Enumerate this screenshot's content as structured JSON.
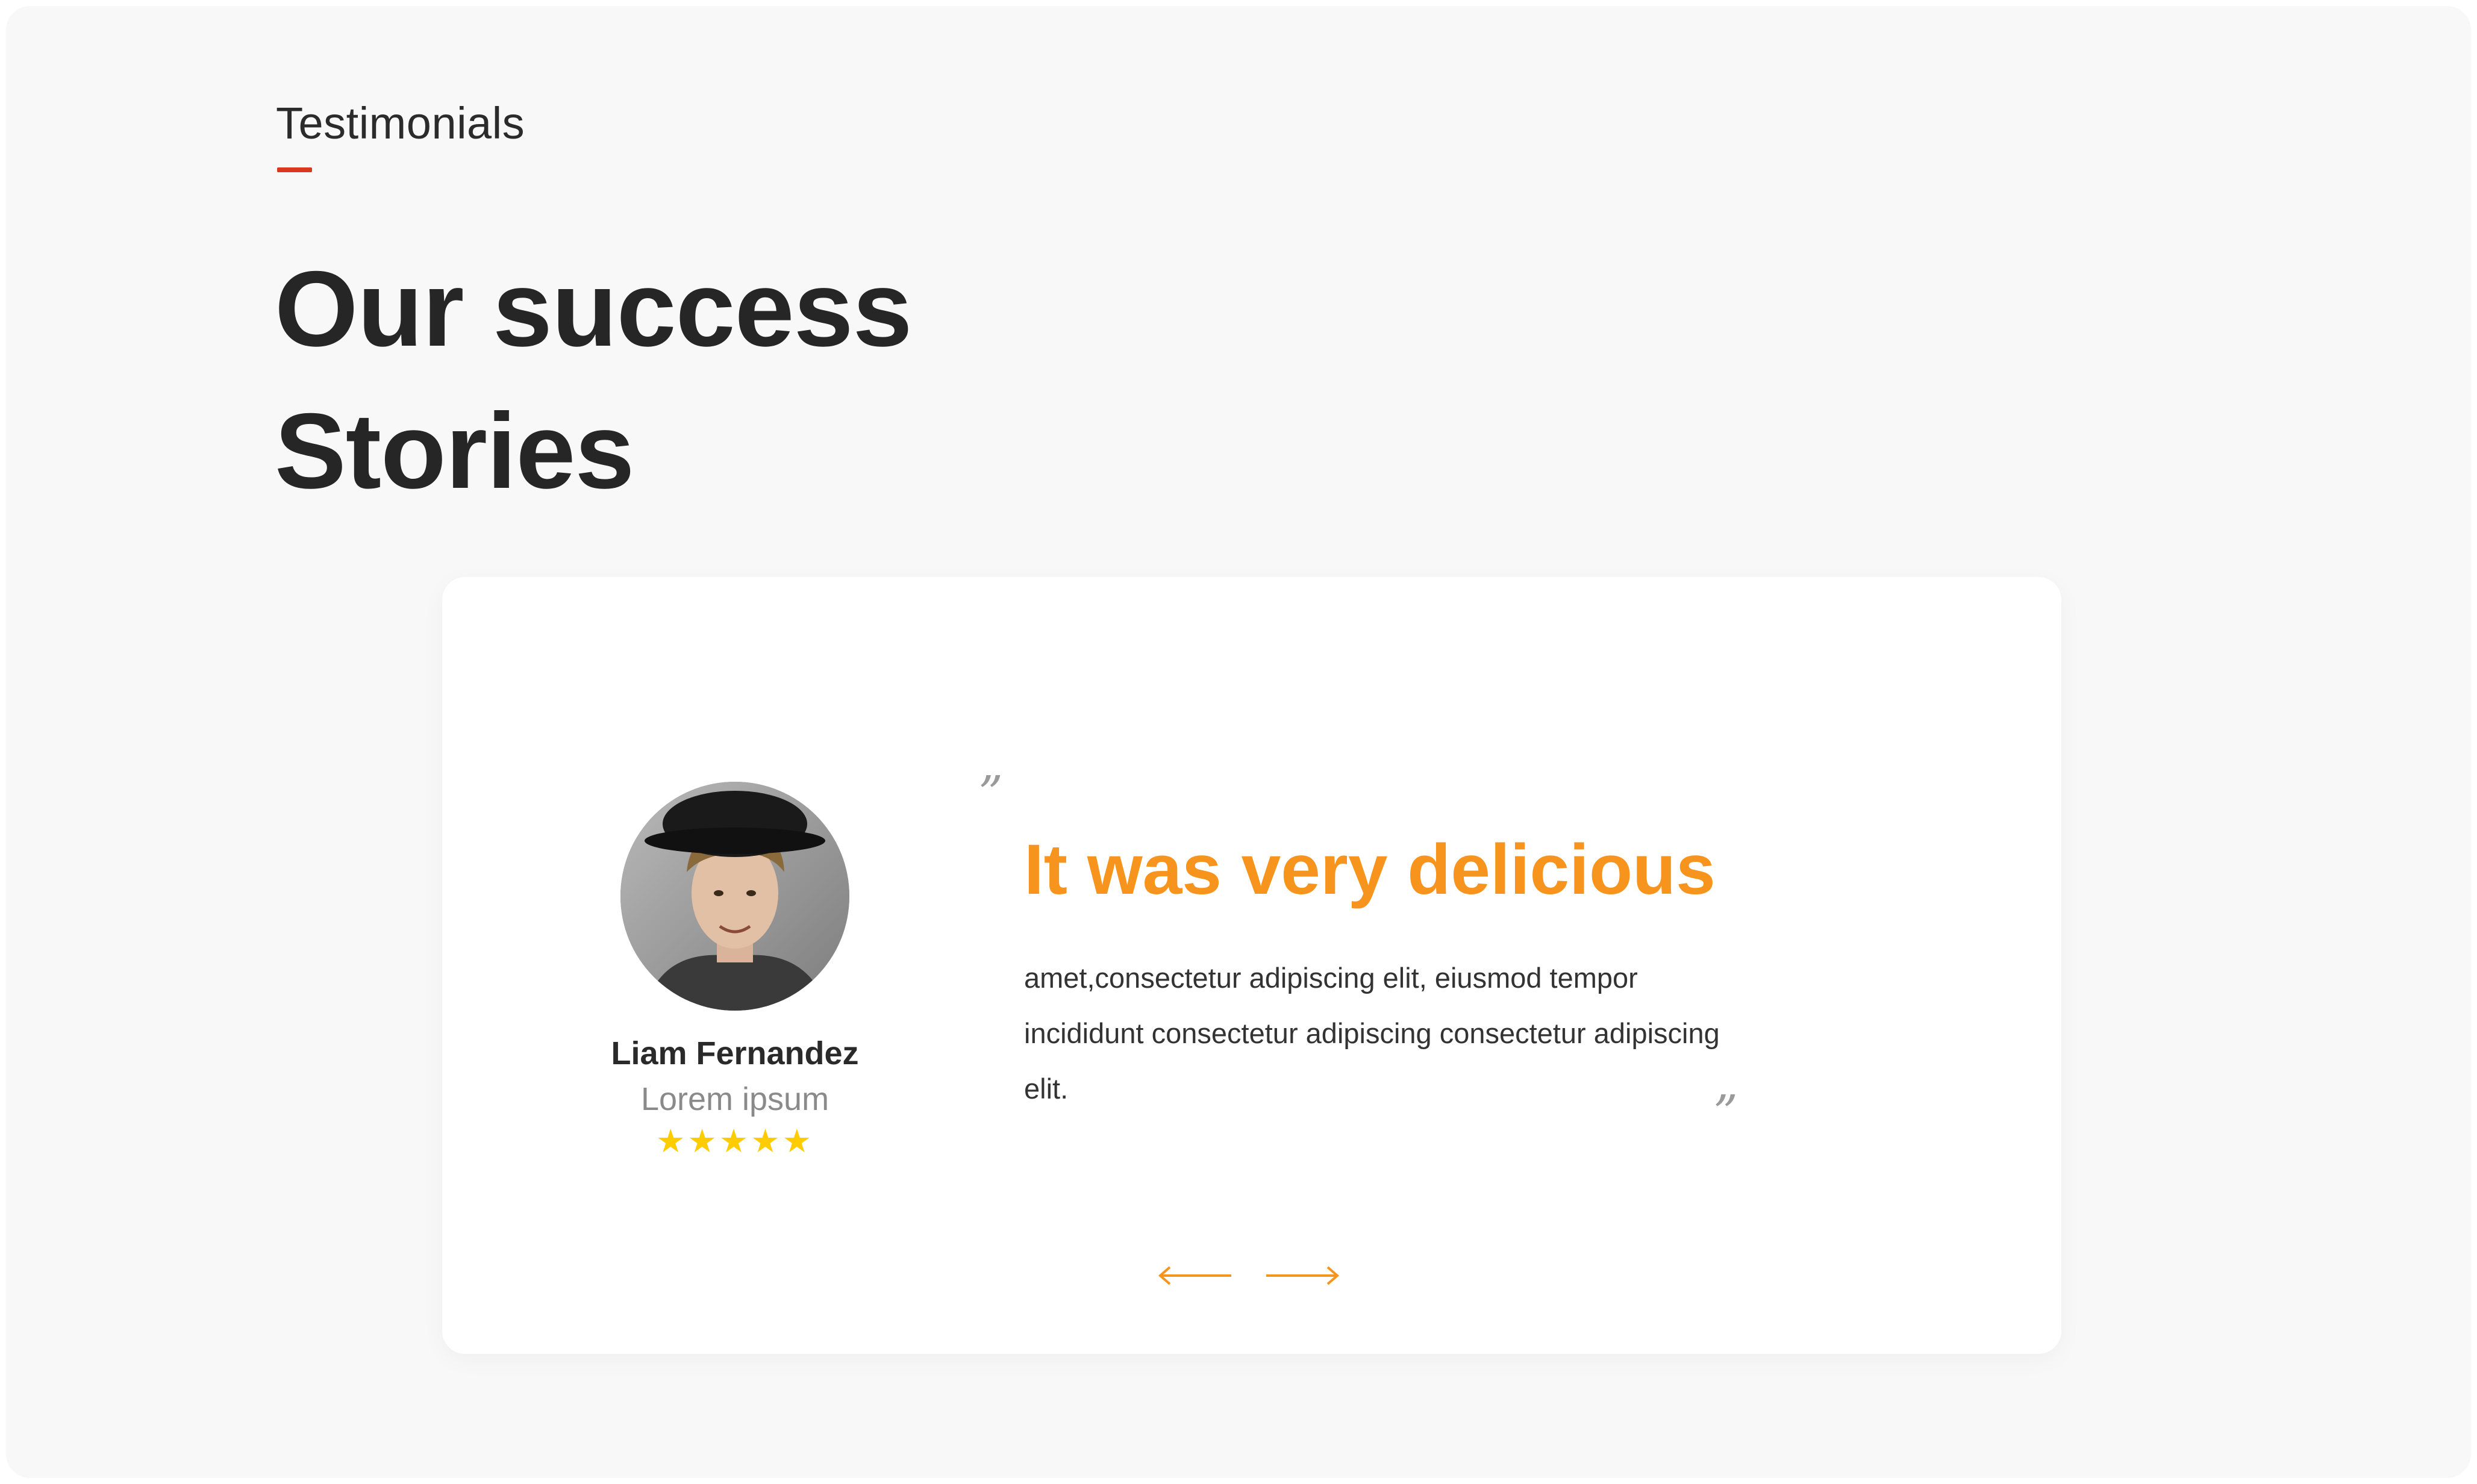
{
  "section": {
    "eyebrow": "Testimonials",
    "heading_line1": "Our success",
    "heading_line2": "Stories"
  },
  "testimonial": {
    "name": "Liam Fernandez",
    "role": "Lorem ipsum",
    "rating": 5,
    "stars": "★★★★★",
    "quote_title": "It was very delicious",
    "quote_body": "amet,consectetur adipiscing elit, eiusmod tempor incididunt consectetur adipiscing consectetur adipiscing elit.",
    "open_quote_mark": "”",
    "close_quote_mark": "”"
  },
  "navigation": {
    "prev_icon": "arrow-left-icon",
    "next_icon": "arrow-right-icon"
  },
  "colors": {
    "accent": "#f7941d",
    "eyebrow_underline": "#d8391f",
    "star": "#ffcc00",
    "background": "#f8f8f8",
    "card": "#ffffff"
  }
}
